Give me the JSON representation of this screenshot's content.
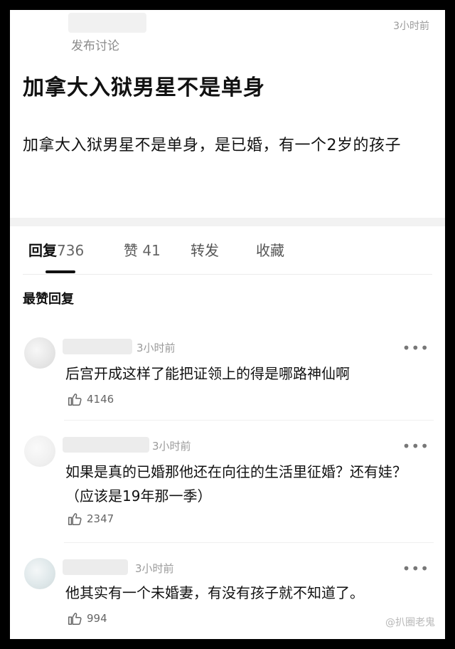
{
  "post": {
    "type_label": "发布讨论",
    "time": "3小时前",
    "title": "加拿大入狱男星不是单身",
    "body": "加拿大入狱男星不是单身，是已婚，有一个2岁的孩子"
  },
  "tabs": [
    {
      "label": "回复",
      "count": "736",
      "active": true
    },
    {
      "label": "赞",
      "count": "41",
      "active": false
    },
    {
      "label": "转发",
      "count": "",
      "active": false
    },
    {
      "label": "收藏",
      "count": "",
      "active": false
    }
  ],
  "section_title": "最赞回复",
  "comments": [
    {
      "time": "3小时前",
      "text": "后宫开成这样了能把证领上的得是哪路神仙啊",
      "likes": "4146"
    },
    {
      "time": "3小时前",
      "text": "如果是真的已婚那他还在向往的生活里征婚？还有娃？（应该是19年那一季）",
      "likes": "2347"
    },
    {
      "time": "3小时前",
      "text": "他其实有一个未婚妻，有没有孩子就不知道了。",
      "likes": "994"
    }
  ],
  "icons": {
    "more": "more-dots-icon",
    "like": "thumbs-up-icon"
  },
  "watermark": "@扒圈老鬼"
}
